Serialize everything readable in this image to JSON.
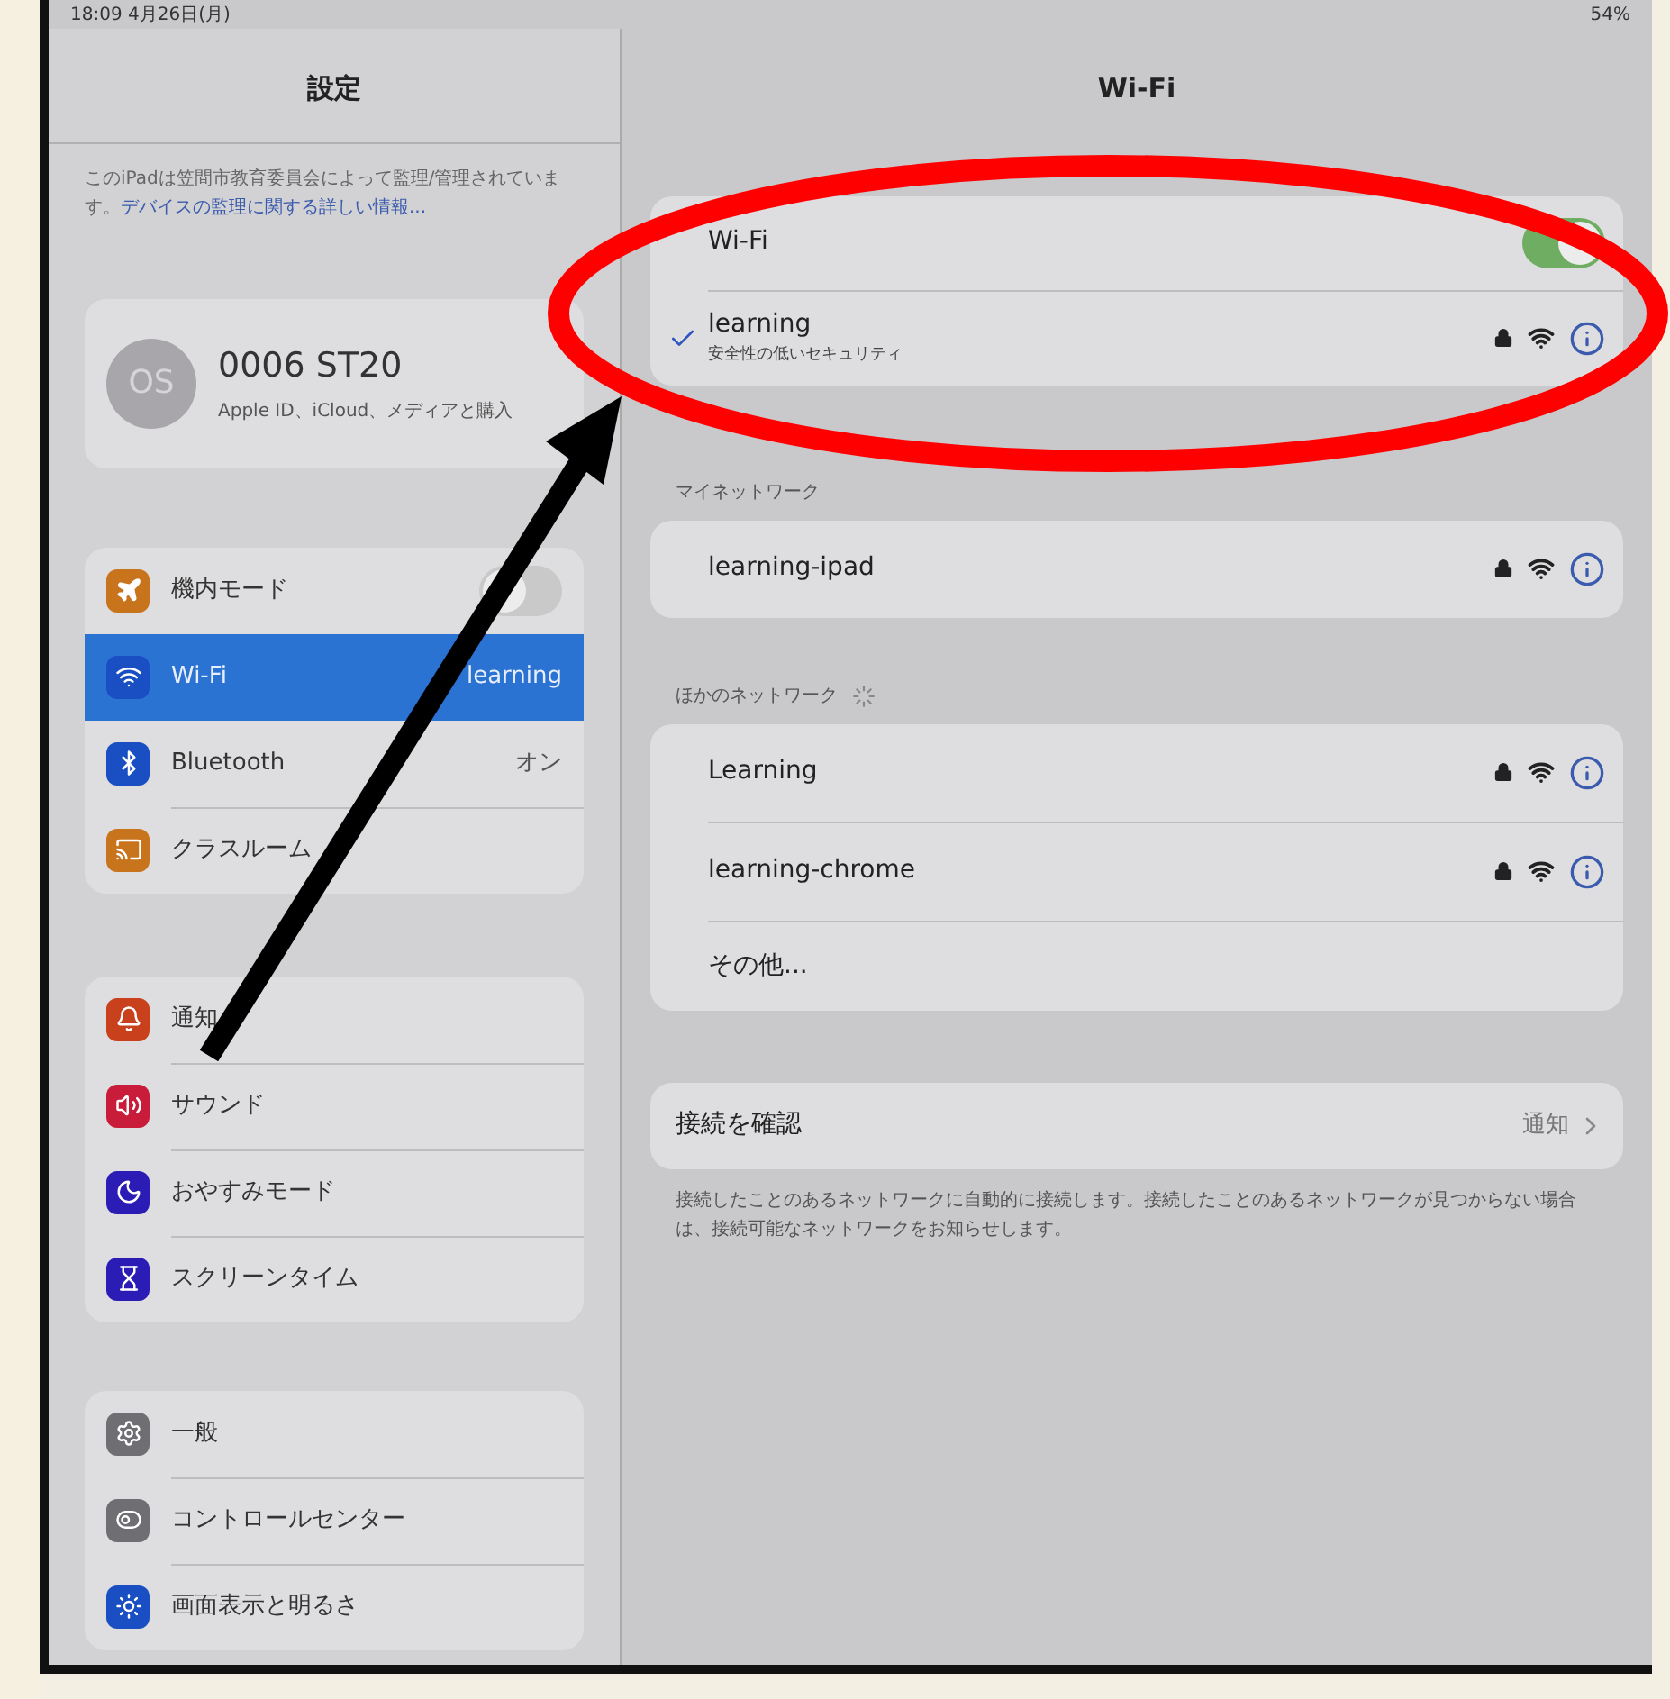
{
  "status_bar": {
    "time": "18:09  4月26日(月)",
    "battery": "54%"
  },
  "sidebar": {
    "title": "設定",
    "notice": {
      "text": "このiPadは笠間市教育委員会によって監理/管理されています。",
      "link": "デバイスの監理に関する詳しい情報..."
    },
    "profile": {
      "initials": "OS",
      "name": "0006 ST20",
      "subtitle": "Apple ID、iCloud、メディアと購入"
    },
    "groups": [
      [
        {
          "kind": "toggle",
          "label": "機内モード",
          "on": false,
          "selected": false,
          "color": "#c8741c"
        },
        {
          "kind": "value",
          "label": "Wi-Fi",
          "value": "learning",
          "selected": true,
          "color": "#1a4fc4"
        },
        {
          "kind": "value",
          "label": "Bluetooth",
          "value": "オン",
          "selected": false,
          "color": "#1a4fc4"
        },
        {
          "kind": "plain",
          "label": "クラスルーム",
          "selected": false,
          "color": "#c8741c"
        }
      ],
      [
        {
          "kind": "plain",
          "label": "通知",
          "selected": false,
          "color": "#c8401c"
        },
        {
          "kind": "plain",
          "label": "サウンド",
          "selected": false,
          "color": "#c81c3a"
        },
        {
          "kind": "plain",
          "label": "おやすみモード",
          "selected": false,
          "color": "#2a1cb4"
        },
        {
          "kind": "plain",
          "label": "スクリーンタイム",
          "selected": false,
          "color": "#2a1cb4"
        }
      ],
      [
        {
          "kind": "plain",
          "label": "一般",
          "selected": false,
          "color": "#6e6e73"
        },
        {
          "kind": "plain",
          "label": "コントロールセンター",
          "selected": false,
          "color": "#6e6e73"
        },
        {
          "kind": "plain",
          "label": "画面表示と明るさ",
          "selected": false,
          "color": "#1a4fc4"
        }
      ]
    ]
  },
  "detail": {
    "title": "Wi-Fi",
    "wifi": {
      "label": "Wi-Fi",
      "on": true
    },
    "connected": {
      "name": "learning",
      "subtitle": "安全性の低いセキュリティ",
      "checked": true,
      "secured": true
    },
    "sections": [
      {
        "header": "マイネットワーク",
        "loading": false,
        "networks": [
          {
            "name": "learning-ipad",
            "secured": true
          }
        ]
      },
      {
        "header": "ほかのネットワーク",
        "loading": true,
        "networks": [
          {
            "name": "Learning",
            "secured": true
          },
          {
            "name": "learning-chrome",
            "secured": true
          }
        ],
        "other": "その他..."
      }
    ],
    "ask": {
      "label": "接続を確認",
      "value": "通知"
    },
    "footer": "接続したことのあるネットワークに自動的に接続します。接続したことのあるネットワークが見つからない場合は、接続可能なネットワークをお知らせします。"
  }
}
